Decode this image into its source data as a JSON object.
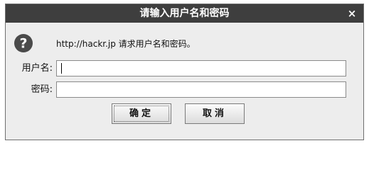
{
  "window": {
    "title": "请输入用户名和密码",
    "close_label": "×"
  },
  "icon": {
    "name": "help-icon",
    "glyph": "?",
    "color": "#4a4a4a"
  },
  "message": "http://hackr.jp 请求用户名和密码。",
  "form": {
    "username_label": "用户名:",
    "username_value": "",
    "password_label": "密码:",
    "password_value": ""
  },
  "buttons": {
    "ok_label": "确定",
    "cancel_label": "取消"
  }
}
